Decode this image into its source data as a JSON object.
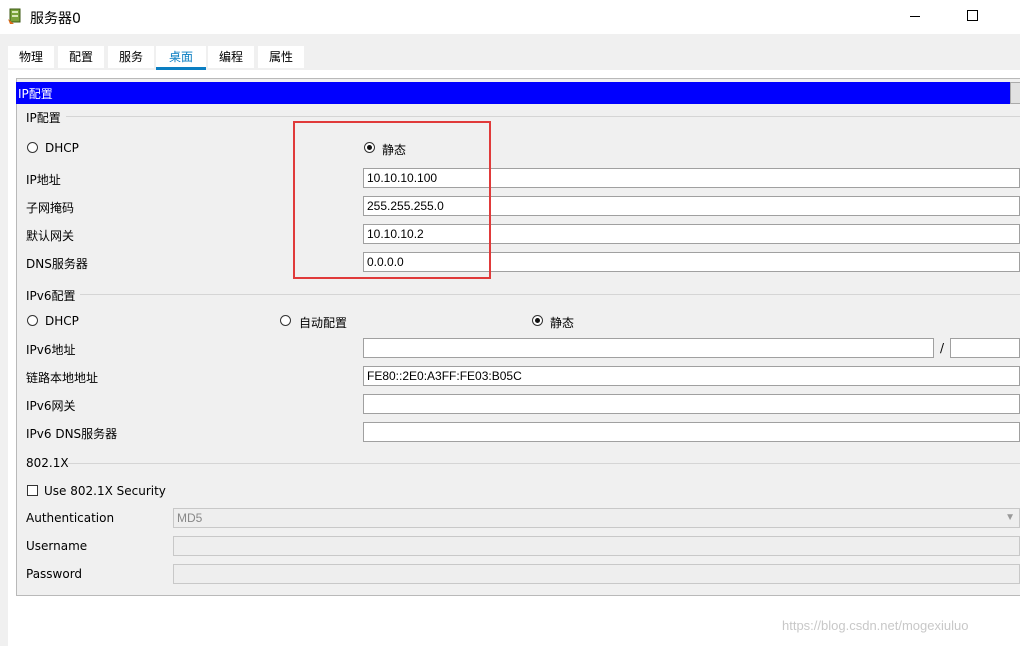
{
  "window": {
    "title": "服务器0"
  },
  "tabs": [
    "物理",
    "配置",
    "服务",
    "桌面",
    "编程",
    "属性"
  ],
  "active_tab": "桌面",
  "panel": {
    "header": "IP配置"
  },
  "ipv4": {
    "group_title": "IP配置",
    "dhcp_label": "DHCP",
    "static_label": "静态",
    "mode": "static",
    "ip_label": "IP地址",
    "ip_value": "10.10.10.100",
    "mask_label": "子网掩码",
    "mask_value": "255.255.255.0",
    "gateway_label": "默认网关",
    "gateway_value": "10.10.10.2",
    "dns_label": "DNS服务器",
    "dns_value": "0.0.0.0"
  },
  "ipv6": {
    "group_title": "IPv6配置",
    "dhcp_label": "DHCP",
    "auto_label": "自动配置",
    "static_label": "静态",
    "mode": "static",
    "addr_label": "IPv6地址",
    "addr_value": "",
    "prefix_sep": "/",
    "prefix_value": "",
    "link_local_label": "链路本地地址",
    "link_local_value": "FE80::2E0:A3FF:FE03:B05C",
    "gateway_label": "IPv6网关",
    "gateway_value": "",
    "dns_label": "IPv6 DNS服务器",
    "dns_value": ""
  },
  "dot1x": {
    "group_title": "802.1X",
    "use_label": "Use 802.1X Security",
    "checked": false,
    "auth_label": "Authentication",
    "auth_value": "MD5",
    "username_label": "Username",
    "username_value": "",
    "password_label": "Password",
    "password_value": ""
  },
  "watermark": "https://blog.csdn.net/mogexiuluo",
  "colors": {
    "accent": "#0a7ec2",
    "header_bar": "#0000ff",
    "highlight_box": "#e03a3a"
  }
}
